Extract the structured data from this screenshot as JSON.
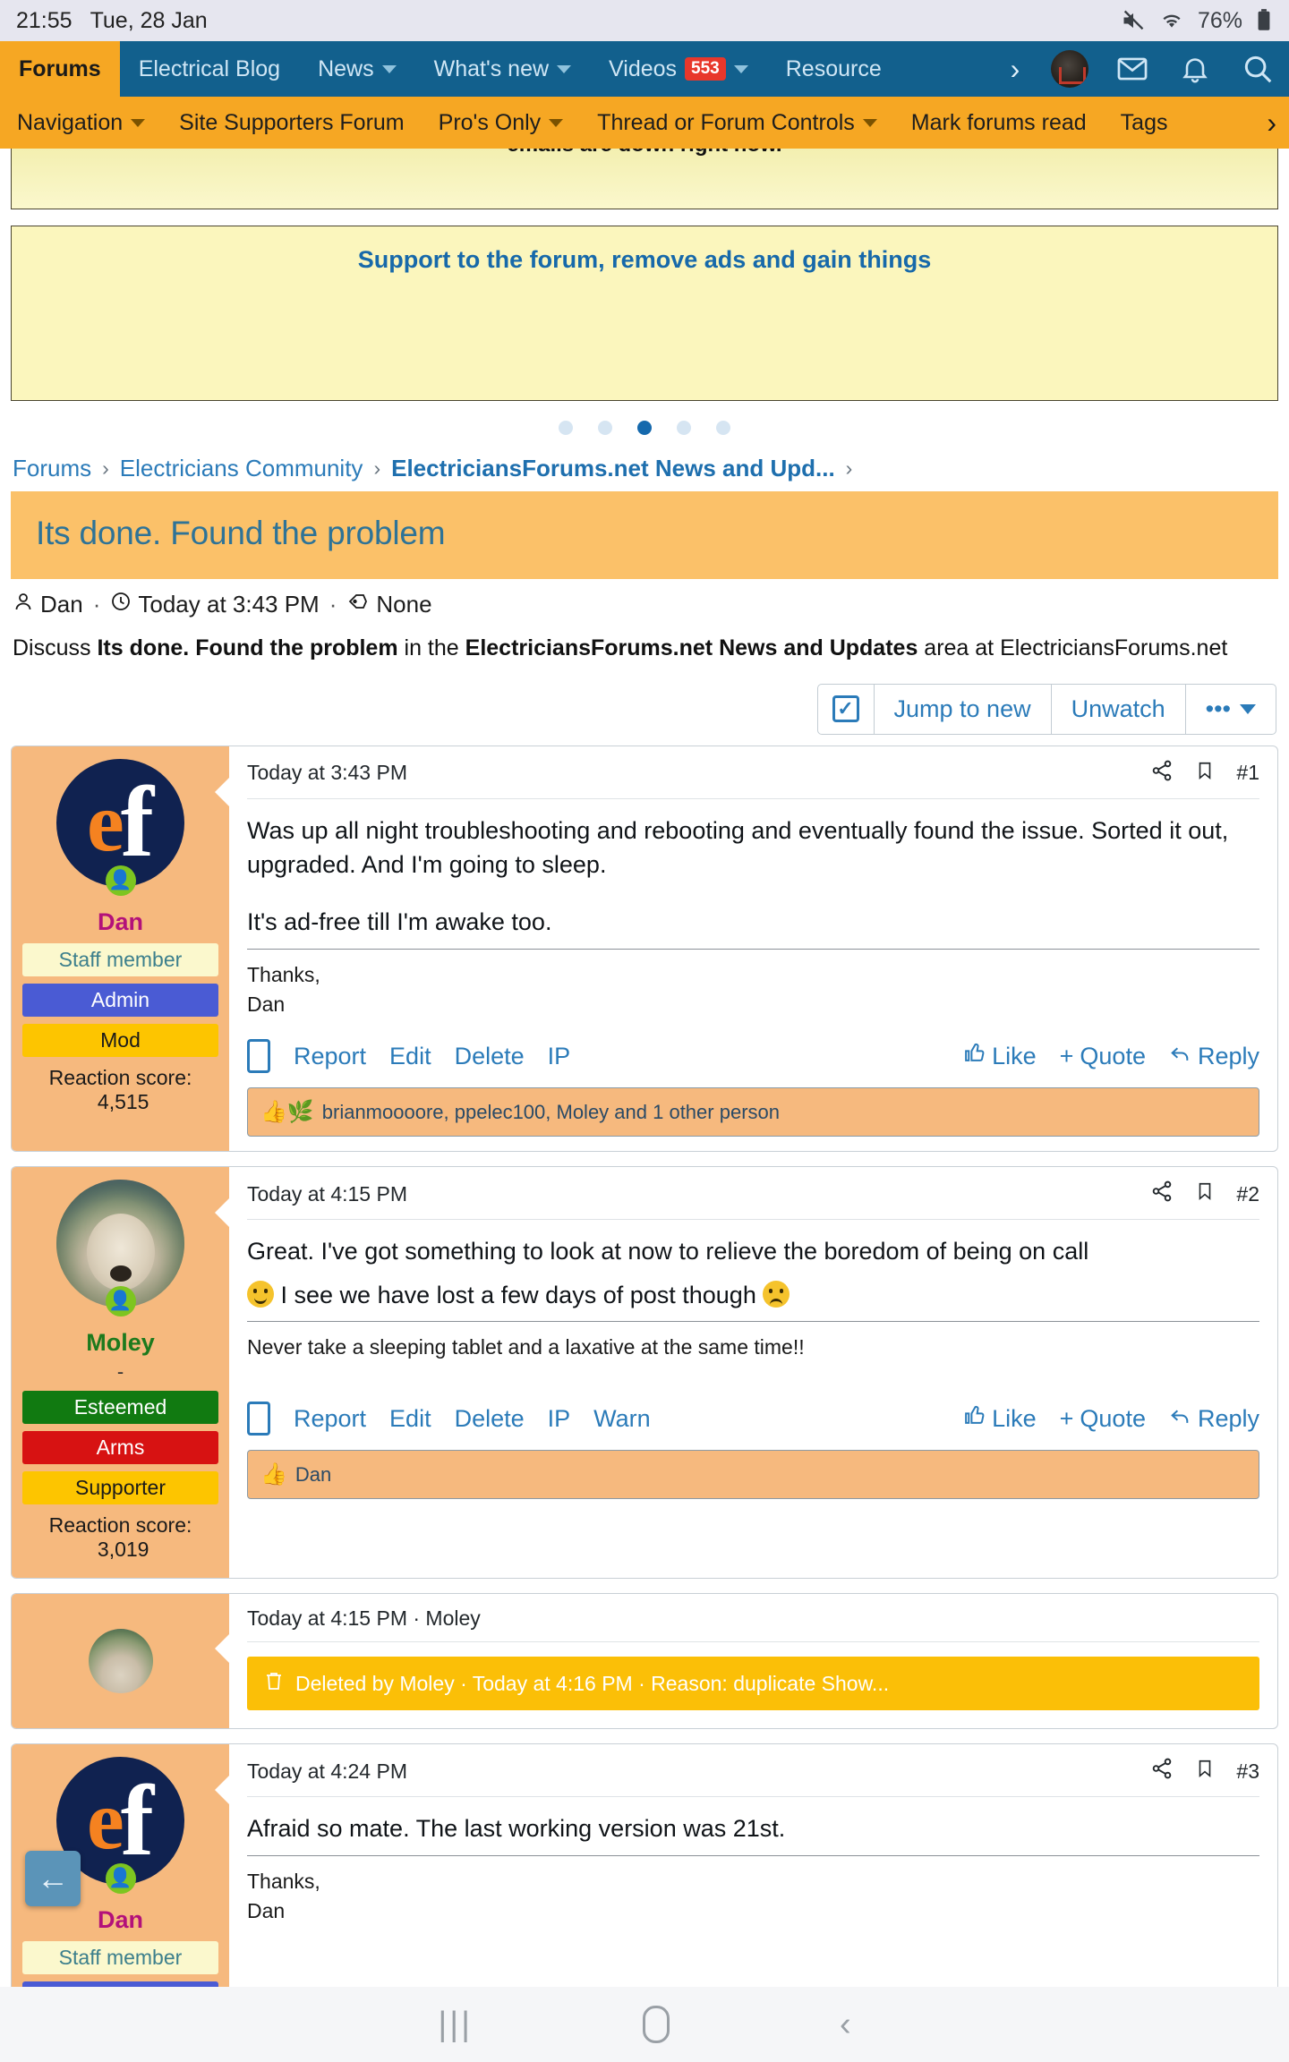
{
  "statusbar": {
    "time": "21:55",
    "date": "Tue, 28 Jan",
    "battery": "76%",
    "mute_icon": "mute-icon",
    "wifi_icon": "wifi-icon",
    "battery_icon": "battery-icon"
  },
  "navbar": {
    "items": [
      {
        "label": "Forums",
        "active": true,
        "caret": false
      },
      {
        "label": "Electrical Blog",
        "active": false,
        "caret": false
      },
      {
        "label": "News",
        "active": false,
        "caret": true
      },
      {
        "label": "What's new",
        "active": false,
        "caret": true
      },
      {
        "label": "Videos",
        "active": false,
        "caret": true,
        "badge": "553"
      },
      {
        "label": "Resource",
        "active": false,
        "caret": false
      }
    ],
    "overflow_icon": "chevron-right-icon",
    "avatar_icon": "user-avatar",
    "inbox_icon": "envelope-icon",
    "alerts_icon": "bell-icon",
    "search_icon": "search-icon"
  },
  "subnav": {
    "items": [
      {
        "label": "Navigation",
        "caret": true
      },
      {
        "label": "Site Supporters Forum",
        "caret": false
      },
      {
        "label": "Pro's Only",
        "caret": true
      },
      {
        "label": "Thread or Forum Controls",
        "caret": true
      },
      {
        "label": "Mark forums read",
        "caret": false
      },
      {
        "label": "Tags",
        "caret": false
      }
    ],
    "overflow_icon": "chevron-right-icon"
  },
  "ads": {
    "top_cut_text": "emails are down right now.",
    "main_link": "Support to the forum, remove ads and gain things",
    "dots": 5,
    "active_dot": 2
  },
  "breadcrumb": {
    "items": [
      {
        "label": "Forums",
        "current": false
      },
      {
        "label": "Electricians Community",
        "current": false
      },
      {
        "label": "ElectriciansForums.net News and Upd...",
        "current": true
      }
    ],
    "separator": "›",
    "trailing": "›"
  },
  "thread": {
    "title": "Its done. Found the problem",
    "author": "Dan",
    "time": "Today at 3:43 PM",
    "tags": "None",
    "user_icon": "user-icon",
    "clock_icon": "clock-icon",
    "tag_icon": "tag-icon",
    "description_prefix": "Discuss ",
    "description_title": "Its done. Found the problem",
    "description_mid": " in the ",
    "description_forum": "ElectriciansForums.net News and Updates",
    "description_suffix": " area at ElectriciansForums.net"
  },
  "toolbar": {
    "checkbox_icon": "checkbox-checked-icon",
    "jump_label": "Jump to new",
    "unwatch_label": "Unwatch",
    "more_label": "•••"
  },
  "posts": [
    {
      "id": "post-1",
      "author": "Dan",
      "author_color": "#b3117a",
      "avatar": "ef-logo-avatar",
      "user_title": "",
      "badges": [
        {
          "label": "Staff member",
          "bg": "#fbf8cd",
          "fg": "#3c7f8c"
        },
        {
          "label": "Admin",
          "bg": "#4a5bd4",
          "fg": "#ffffff"
        },
        {
          "label": "Mod",
          "bg": "#fdc500",
          "fg": "#1a1a1a"
        }
      ],
      "reaction_score_label": "Reaction score:",
      "reaction_score_value": "4,515",
      "time": "Today at 3:43 PM",
      "share_icon": "share-icon",
      "bookmark_icon": "bookmark-icon",
      "number": "#1",
      "paragraphs": [
        "Was up all night troubleshooting and rebooting and eventually found the issue. Sorted it out, upgraded. And I'm going to sleep.",
        "It's ad-free till I'm awake too."
      ],
      "signature": [
        "Thanks,",
        "Dan"
      ],
      "actions_left": [
        "Report",
        "Edit",
        "Delete",
        "IP"
      ],
      "actions_right": [
        "Like",
        "Quote",
        "Reply"
      ],
      "reactions_text": "brianmoooore, ppelec100, Moley and 1 other person",
      "reaction_emojis": "👍🌿"
    },
    {
      "id": "post-2",
      "author": "Moley",
      "author_color": "#1d7a1d",
      "avatar": "sheep-avatar",
      "user_title": "-",
      "badges": [
        {
          "label": "Esteemed",
          "bg": "#117a11",
          "fg": "#ffffff"
        },
        {
          "label": "Arms",
          "bg": "#d71212",
          "fg": "#ffffff"
        },
        {
          "label": "Supporter",
          "bg": "#fdc500",
          "fg": "#1a1a1a"
        }
      ],
      "reaction_score_label": "Reaction score:",
      "reaction_score_value": "3,019",
      "time": "Today at 4:15 PM",
      "share_icon": "share-icon",
      "bookmark_icon": "bookmark-icon",
      "number": "#2",
      "body_line_1": "Great. I've got something to look at now to relieve the boredom of being on call",
      "body_line_2": "I see we have lost a few days of post though",
      "signature": [
        "Never take a sleeping tablet and a laxative at the same time!!"
      ],
      "actions_left": [
        "Report",
        "Edit",
        "Delete",
        "IP",
        "Warn"
      ],
      "actions_right": [
        "Like",
        "Quote",
        "Reply"
      ],
      "reactions_text": "Dan",
      "reaction_emojis": "👍"
    }
  ],
  "deleted_post": {
    "head": "Today at 4:15 PM · Moley",
    "avatar": "sheep-avatar",
    "trash_icon": "trash-icon",
    "notice": "Deleted by Moley · Today at 4:16 PM · Reason: duplicate Show..."
  },
  "post3": {
    "id": "post-3",
    "author": "Dan",
    "avatar": "ef-logo-avatar",
    "badges": [
      {
        "label": "Staff member",
        "bg": "#fbf8cd",
        "fg": "#3c7f8c"
      }
    ],
    "time": "Today at 4:24 PM",
    "share_icon": "share-icon",
    "bookmark_icon": "bookmark-icon",
    "number": "#3",
    "paragraphs": [
      "Afraid so mate. The last working version was 21st."
    ],
    "signature": [
      "Thanks,",
      "Dan"
    ]
  },
  "fab": {
    "icon": "arrow-left-icon"
  },
  "sysnav": {
    "recents_icon": "recents-icon",
    "home_icon": "home-icon",
    "back_icon": "back-icon"
  }
}
